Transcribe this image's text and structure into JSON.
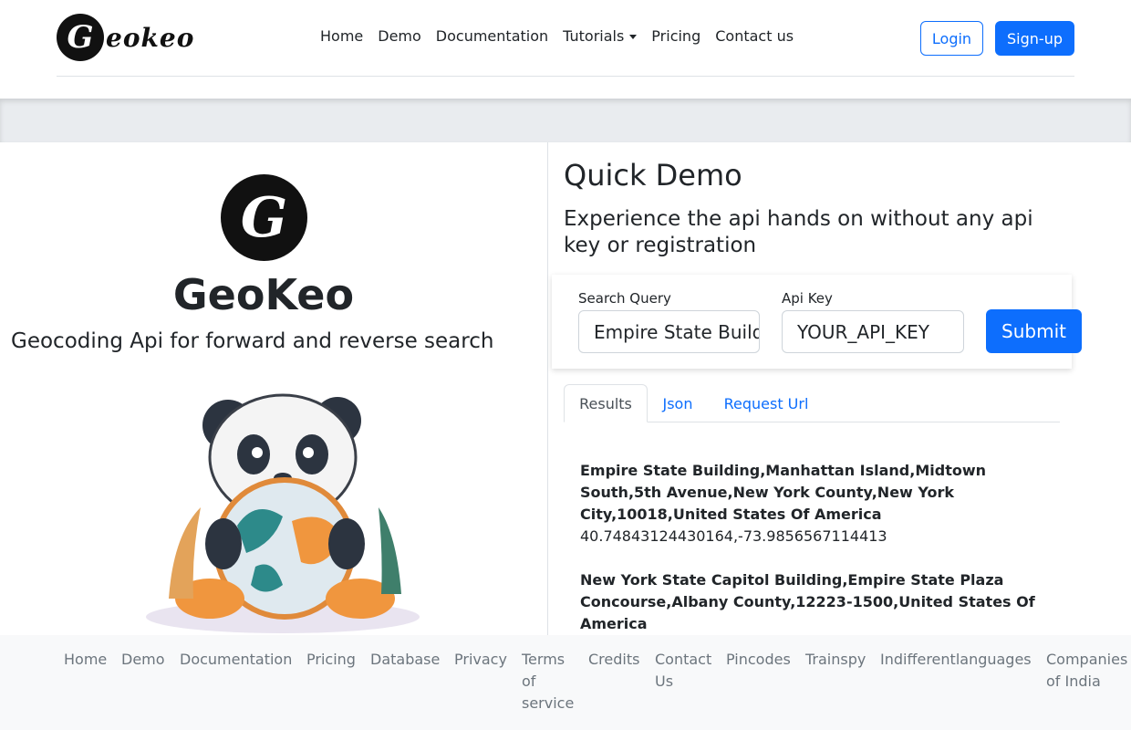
{
  "brand": {
    "logo_letter": "G",
    "name": "eokeo"
  },
  "nav": {
    "links": [
      "Home",
      "Demo",
      "Documentation",
      "Tutorials",
      "Pricing",
      "Contact us"
    ],
    "login": "Login",
    "signup": "Sign-up"
  },
  "hero": {
    "logo_letter": "G",
    "title": "GeoKeo",
    "subtitle": "Geocoding Api for forward and reverse search"
  },
  "demo": {
    "title": "Quick Demo",
    "subtitle": "Experience the api hands on without any api key or registration",
    "search_label": "Search Query",
    "search_value": "Empire State Building",
    "apikey_label": "Api Key",
    "apikey_value": "YOUR_API_KEY",
    "submit": "Submit",
    "tabs": [
      "Results",
      "Json",
      "Request Url"
    ],
    "results": [
      {
        "name": "Empire State Building,Manhattan Island,Midtown South,5th Avenue,New York County,New York City,10018,United States Of America",
        "coords": "40.74843124430164,-73.9856567114413"
      },
      {
        "name": "New York State Capitol Building,Empire State Plaza Concourse,Albany County,12223-1500,United States Of America",
        "coords": ""
      }
    ]
  },
  "footer": {
    "links": [
      "Home",
      "Demo",
      "Documentation",
      "Pricing",
      "Database",
      "Privacy",
      "Terms of service",
      "Credits",
      "Contact Us",
      "Pincodes",
      "Trainspy",
      "Indifferentlanguages",
      "Companies of India"
    ]
  },
  "colors": {
    "primary": "#0d6efd",
    "text": "#212529",
    "muted": "#6c757d"
  }
}
